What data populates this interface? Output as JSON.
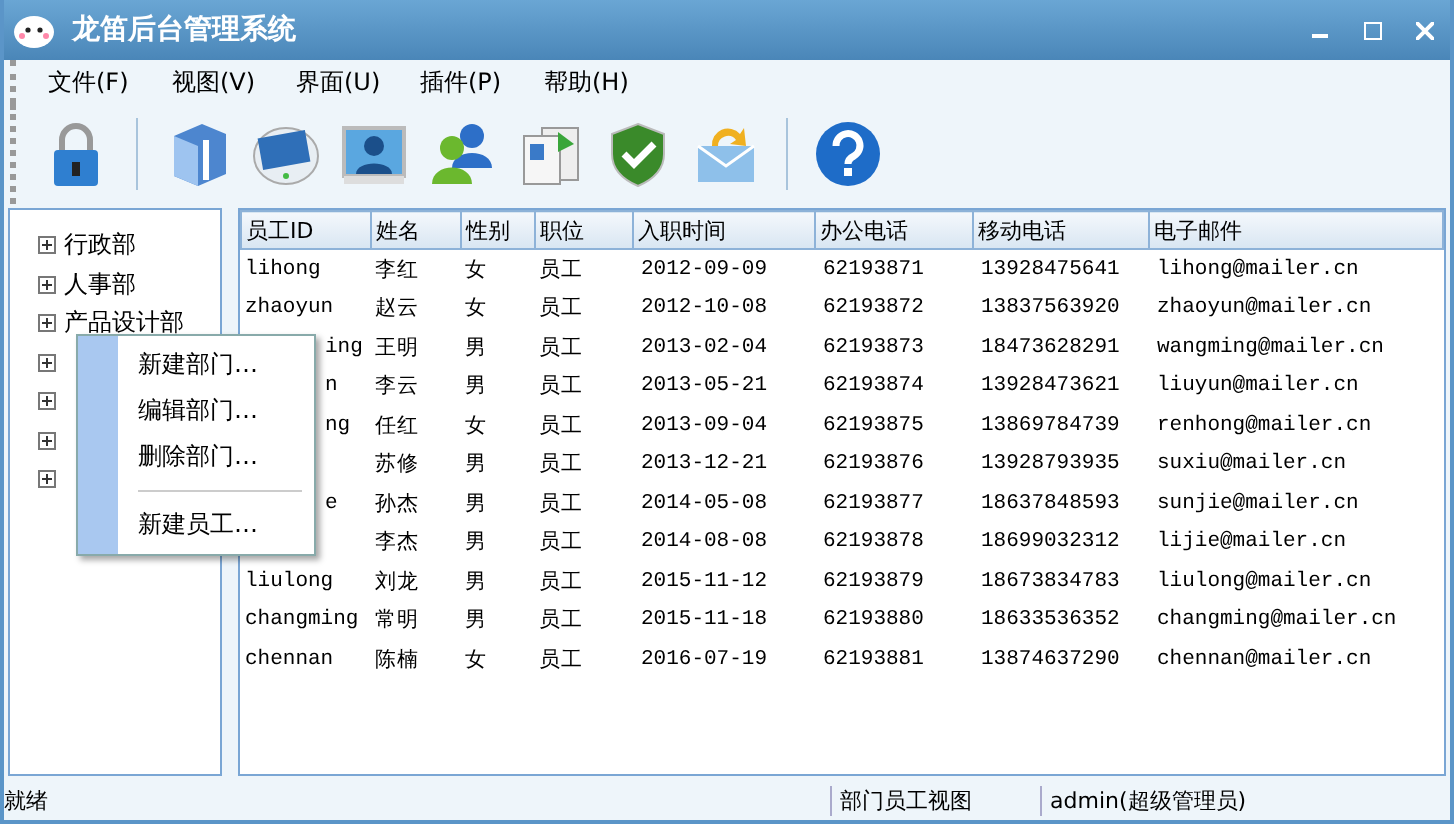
{
  "window": {
    "title": "龙笛后台管理系统"
  },
  "menu": [
    "文件(F)",
    "视图(V)",
    "界面(U)",
    "插件(P)",
    "帮助(H)"
  ],
  "toolbar": [
    {
      "kind": "lock"
    },
    {
      "kind": "sep"
    },
    {
      "kind": "box"
    },
    {
      "kind": "monitor"
    },
    {
      "kind": "user"
    },
    {
      "kind": "users"
    },
    {
      "kind": "docs"
    },
    {
      "kind": "shield"
    },
    {
      "kind": "mail"
    },
    {
      "kind": "sep"
    },
    {
      "kind": "help"
    }
  ],
  "tree": [
    {
      "label": "行政部",
      "expanded": false
    },
    {
      "label": "人事部",
      "expanded": false
    },
    {
      "label": "产品设计部",
      "expanded": false
    },
    {
      "expanded": false
    },
    {
      "expanded": false
    },
    {
      "expanded": false
    },
    {
      "expanded": false
    }
  ],
  "context_menu": {
    "items": [
      {
        "label": "新建部门…",
        "kind": "item"
      },
      {
        "label": "编辑部门…",
        "kind": "item"
      },
      {
        "label": "删除部门…",
        "kind": "item"
      },
      {
        "kind": "sep"
      },
      {
        "label": "新建员工…",
        "kind": "item"
      }
    ]
  },
  "table": {
    "columns": [
      "员工ID",
      "姓名",
      "性别",
      "职位",
      "入职时间",
      "办公电话",
      "移动电话",
      "电子邮件"
    ],
    "rows": [
      {
        "covered": false,
        "cells": [
          "lihong",
          "李红",
          "女",
          "员工",
          "2012-09-09",
          "62193871",
          "13928475641",
          "lihong@mailer.cn"
        ]
      },
      {
        "covered": false,
        "cells": [
          "zhaoyun",
          "赵云",
          "女",
          "员工",
          "2012-10-08",
          "62193872",
          "13837563920",
          "zhaoyun@mailer.cn"
        ]
      },
      {
        "covered": true,
        "cells": [
          "ing",
          "王明",
          "男",
          "员工",
          "2013-02-04",
          "62193873",
          "18473628291",
          "wangming@mailer.cn"
        ]
      },
      {
        "covered": true,
        "cells": [
          "n",
          "李云",
          "男",
          "员工",
          "2013-05-21",
          "62193874",
          "13928473621",
          "liuyun@mailer.cn"
        ]
      },
      {
        "covered": true,
        "cells": [
          "ng",
          "任红",
          "女",
          "员工",
          "2013-09-04",
          "62193875",
          "13869784739",
          "renhong@mailer.cn"
        ]
      },
      {
        "cells": [
          "",
          "苏修",
          "男",
          "员工",
          "2013-12-21",
          "62193876",
          "13928793935",
          "suxiu@mailer.cn"
        ]
      },
      {
        "covered": true,
        "cells": [
          "e",
          "孙杰",
          "男",
          "员工",
          "2014-05-08",
          "62193877",
          "18637848593",
          "sunjie@mailer.cn"
        ]
      },
      {
        "cells": [
          "",
          "李杰",
          "男",
          "员工",
          "2014-08-08",
          "62193878",
          "18699032312",
          "lijie@mailer.cn"
        ]
      },
      {
        "covered": false,
        "cells": [
          "liulong",
          "刘龙",
          "男",
          "员工",
          "2015-11-12",
          "62193879",
          "18673834783",
          "liulong@mailer.cn"
        ]
      },
      {
        "covered": false,
        "cells": [
          "changming",
          "常明",
          "男",
          "员工",
          "2015-11-18",
          "62193880",
          "18633536352",
          "changming@mailer.cn"
        ]
      },
      {
        "covered": false,
        "cells": [
          "chennan",
          "陈楠",
          "女",
          "员工",
          "2016-07-19",
          "62193881",
          "13874637290",
          "chennan@mailer.cn"
        ]
      }
    ]
  },
  "status_bar": [
    "就绪",
    "部门员工视图",
    "admin(超级管理员)"
  ]
}
